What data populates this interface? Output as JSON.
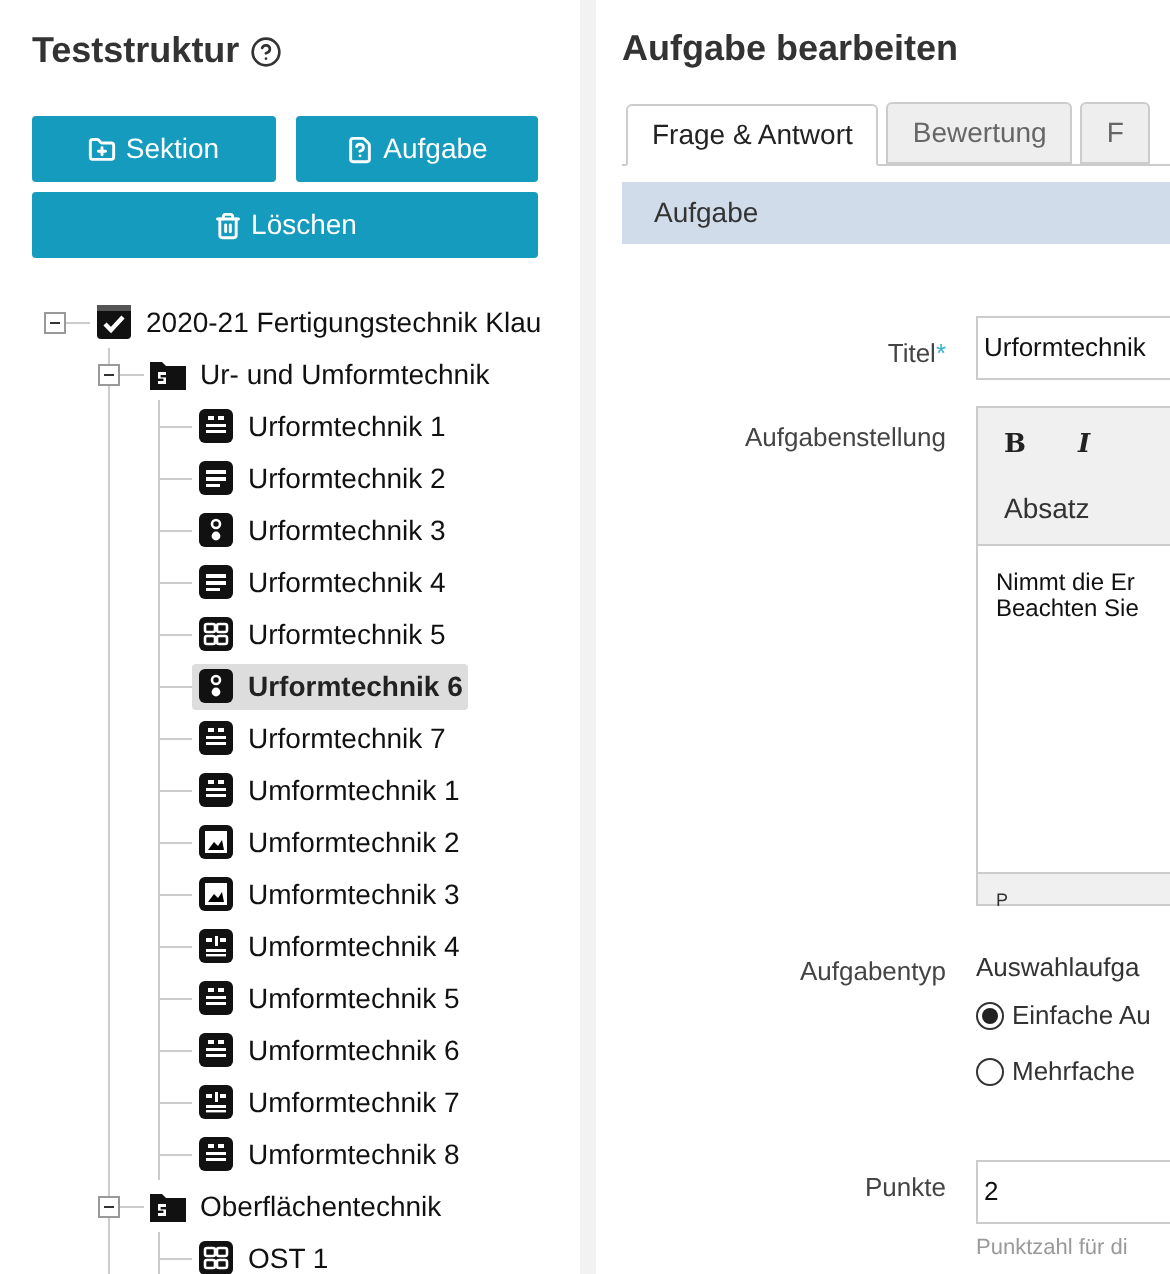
{
  "sidebar": {
    "title": "Teststruktur",
    "buttons": [
      {
        "label": "Sektion",
        "kind": "section"
      },
      {
        "label": "Aufgabe",
        "kind": "task"
      },
      {
        "label": "Löschen",
        "kind": "delete"
      }
    ],
    "tree": [
      {
        "label": "2020-21 Fertigungstechnik Klau",
        "kind": "test",
        "expanded": true,
        "selected": false,
        "children": [
          {
            "label": "Ur- und Umformtechnik",
            "kind": "section",
            "expanded": true,
            "selected": false,
            "children": [
              {
                "label": "Urformtechnik 1",
                "kind": "gap",
                "selected": false
              },
              {
                "label": "Urformtechnik 2",
                "kind": "text",
                "selected": false
              },
              {
                "label": "Urformtechnik 3",
                "kind": "single",
                "selected": false
              },
              {
                "label": "Urformtechnik 4",
                "kind": "text",
                "selected": false
              },
              {
                "label": "Urformtechnik 5",
                "kind": "grid",
                "selected": false
              },
              {
                "label": "Urformtechnik 6",
                "kind": "single",
                "selected": true
              },
              {
                "label": "Urformtechnik 7",
                "kind": "gap",
                "selected": false
              },
              {
                "label": "Umformtechnik 1",
                "kind": "gap",
                "selected": false
              },
              {
                "label": "Umformtechnik 2",
                "kind": "image",
                "selected": false
              },
              {
                "label": "Umformtechnik 3",
                "kind": "image",
                "selected": false
              },
              {
                "label": "Umformtechnik 4",
                "kind": "cloze",
                "selected": false
              },
              {
                "label": "Umformtechnik 5",
                "kind": "gap",
                "selected": false
              },
              {
                "label": "Umformtechnik 6",
                "kind": "gap",
                "selected": false
              },
              {
                "label": "Umformtechnik 7",
                "kind": "cloze",
                "selected": false
              },
              {
                "label": "Umformtechnik 8",
                "kind": "gap",
                "selected": false
              }
            ]
          },
          {
            "label": "Oberflächentechnik",
            "kind": "section",
            "expanded": true,
            "selected": false,
            "children": [
              {
                "label": "OST 1",
                "kind": "grid",
                "selected": false
              }
            ]
          }
        ]
      }
    ]
  },
  "form": {
    "title": "Aufgabe bearbeiten",
    "tabs": [
      {
        "label": "Frage & Antwort",
        "selected": true
      },
      {
        "label": "Bewertung",
        "selected": false
      },
      {
        "label": "F",
        "selected": false
      }
    ],
    "section": "Aufgabe",
    "fields": [
      {
        "kind": "text",
        "label": "Titel",
        "required_mark": "*",
        "value": "Urformtechnik"
      },
      {
        "kind": "richtext",
        "label": "Aufgabenstellung",
        "toolbar": [
          "B",
          "I"
        ],
        "format": "Absatz",
        "lines": [
          "Nimmt die Er",
          "Beachten Sie"
        ],
        "path": "P"
      },
      {
        "kind": "choice",
        "label": "Aufgabentyp",
        "value": "Auswahlaufga",
        "options": [
          {
            "label": "Einfache Au",
            "selected": true
          },
          {
            "label": "Mehrfache",
            "selected": false
          }
        ]
      },
      {
        "kind": "number",
        "label": "Punkte",
        "value": "2",
        "hint": "Punktzahl für di"
      }
    ]
  }
}
